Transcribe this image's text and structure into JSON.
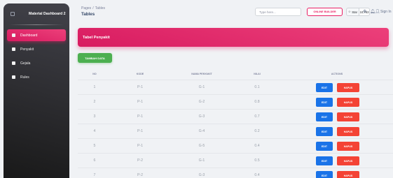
{
  "sidebar": {
    "brand": "Material Dashboard 2",
    "items": [
      {
        "label": "Dashboard",
        "active": true
      },
      {
        "label": "Penyakit",
        "active": false
      },
      {
        "label": "Gejala",
        "active": false
      },
      {
        "label": "Rules",
        "active": false
      }
    ]
  },
  "header": {
    "breadcrumb_root": "Pages",
    "breadcrumb_sep": "/",
    "breadcrumb_current": "Tables",
    "title": "Tables",
    "search_placeholder": "Type here...",
    "online_button": "ONLINE BUILDER",
    "star_label": "Star",
    "star_count": "10,763",
    "sign_in": "Sign In"
  },
  "card": {
    "title": "Tabel Penyakit",
    "add_button": "TAMBAH DATA"
  },
  "table": {
    "columns": [
      "NO",
      "KODE",
      "NAMA PENYAKIT",
      "NILAI",
      "ACTIONS"
    ],
    "edit_label": "EDIT",
    "delete_label": "HAPUS",
    "rows": [
      {
        "no": "1",
        "kode": "P-1",
        "nama": "G-1",
        "nilai": "0.1"
      },
      {
        "no": "2",
        "kode": "P-1",
        "nama": "G-2",
        "nilai": "0.8"
      },
      {
        "no": "3",
        "kode": "P-1",
        "nama": "G-3",
        "nilai": "0.7"
      },
      {
        "no": "4",
        "kode": "P-1",
        "nama": "G-4",
        "nilai": "0.2"
      },
      {
        "no": "5",
        "kode": "P-1",
        "nama": "G-5",
        "nilai": "0.4"
      },
      {
        "no": "6",
        "kode": "P-2",
        "nama": "G-1",
        "nilai": "0.5"
      },
      {
        "no": "7",
        "kode": "P-2",
        "nama": "G-3",
        "nilai": "0.4"
      }
    ]
  },
  "colors": {
    "accent": "#e91e63",
    "success": "#4caf50",
    "info": "#1a73e8",
    "danger": "#f44335",
    "sidebar_bg": "#191919"
  }
}
